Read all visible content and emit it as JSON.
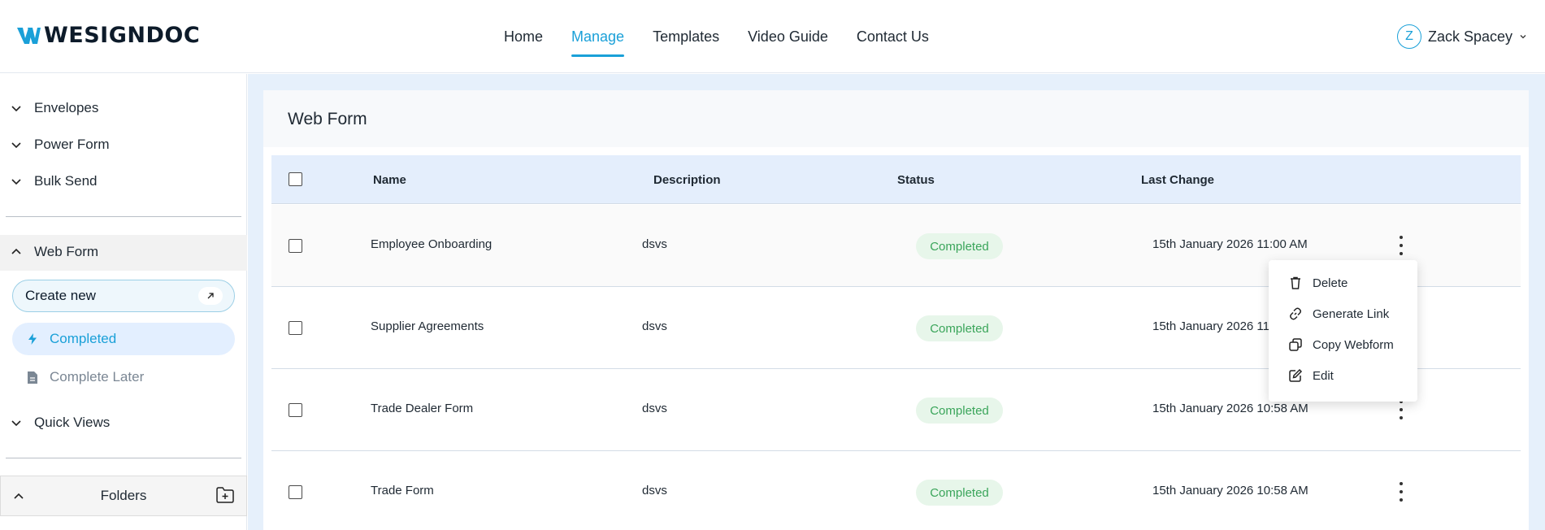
{
  "brand": {
    "name": "WESIGNDOC",
    "accent": "#1aa0d8"
  },
  "nav": {
    "items": [
      {
        "label": "Home",
        "active": false
      },
      {
        "label": "Manage",
        "active": true
      },
      {
        "label": "Templates",
        "active": false
      },
      {
        "label": "Video Guide",
        "active": false
      },
      {
        "label": "Contact Us",
        "active": false
      }
    ]
  },
  "user": {
    "initial": "Z",
    "name": "Zack Spacey"
  },
  "sidebar": {
    "envelopes": "Envelopes",
    "power_form": "Power Form",
    "bulk_send": "Bulk Send",
    "web_form": "Web Form",
    "create_new": "Create new",
    "completed": "Completed",
    "complete_later": "Complete Later",
    "quick_views": "Quick Views",
    "folders": "Folders"
  },
  "page": {
    "title": "Web Form"
  },
  "table": {
    "headers": {
      "name": "Name",
      "description": "Description",
      "status": "Status",
      "last_change": "Last Change"
    },
    "rows": [
      {
        "name": "Employee Onboarding",
        "description": "dsvs",
        "status": "Completed",
        "last_change": "15th January 2026 11:00 AM"
      },
      {
        "name": "Supplier Agreements",
        "description": "dsvs",
        "status": "Completed",
        "last_change": "15th January 2026 11:"
      },
      {
        "name": "Trade Dealer Form",
        "description": "dsvs",
        "status": "Completed",
        "last_change": "15th January 2026 10:58 AM"
      },
      {
        "name": "Trade Form",
        "description": "dsvs",
        "status": "Completed",
        "last_change": "15th January 2026 10:58 AM"
      }
    ]
  },
  "context_menu": {
    "items": [
      {
        "label": "Delete",
        "icon": "trash-icon"
      },
      {
        "label": "Generate Link",
        "icon": "link-icon"
      },
      {
        "label": "Copy Webform",
        "icon": "copy-icon"
      },
      {
        "label": "Edit",
        "icon": "edit-icon"
      }
    ]
  }
}
